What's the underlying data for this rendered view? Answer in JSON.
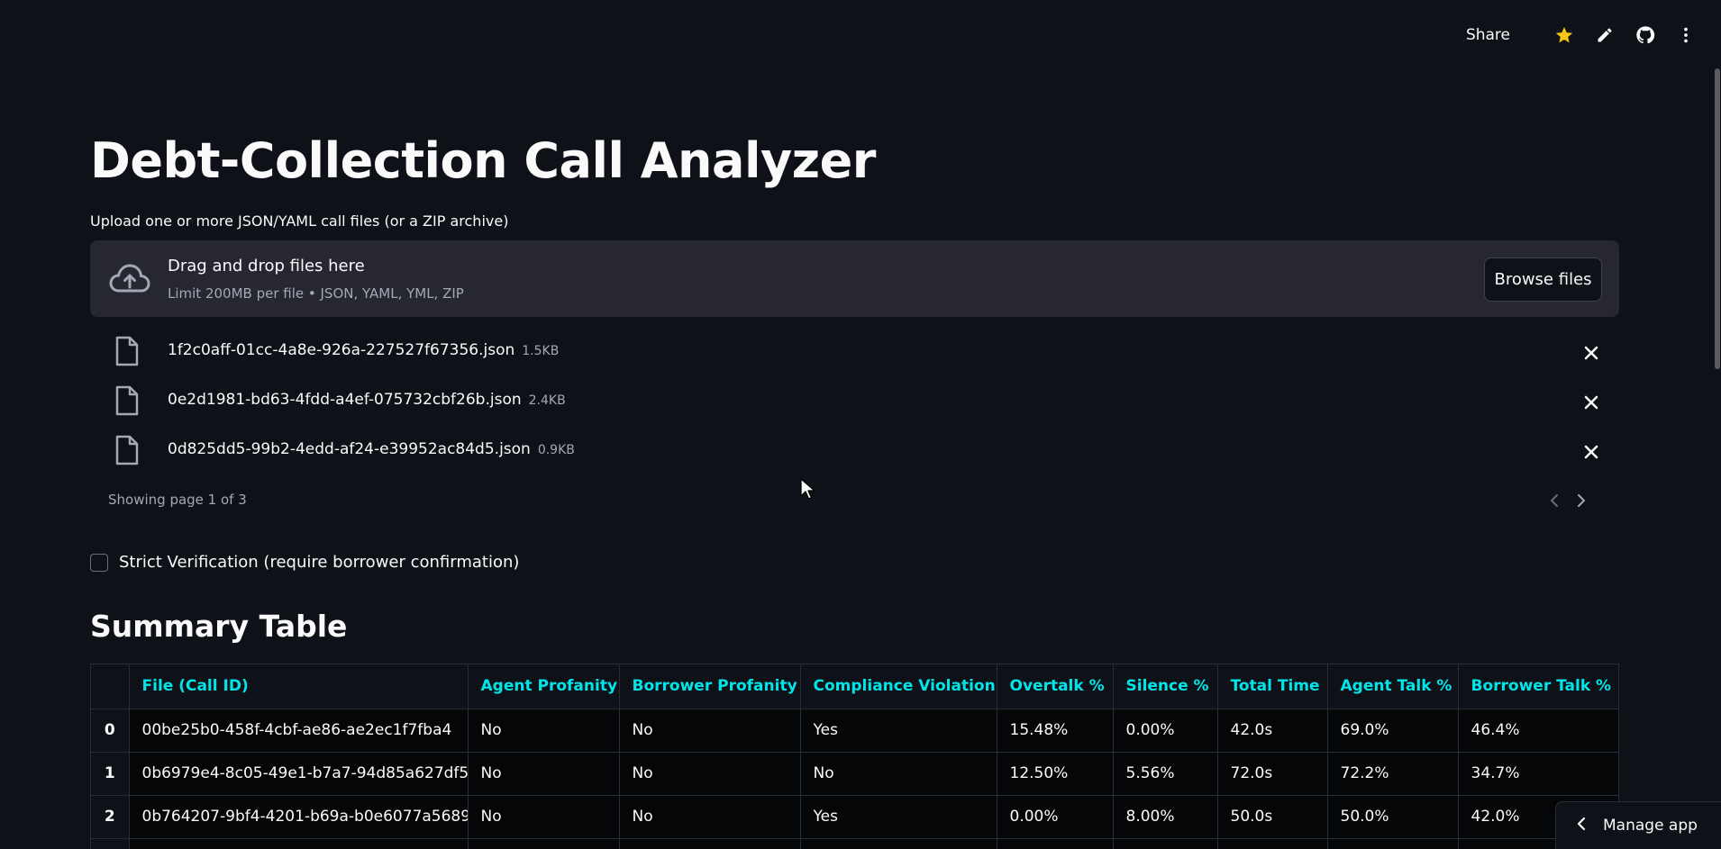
{
  "toolbar": {
    "share_label": "Share",
    "icons": [
      "star-icon",
      "pencil-icon",
      "github-icon",
      "more-vertical-icon"
    ],
    "star_color": "#f5c518"
  },
  "header": {
    "title": "Debt-Collection Call Analyzer"
  },
  "uploader": {
    "label": "Upload one or more JSON/YAML call files (or a ZIP archive)",
    "drop_title": "Drag and drop files here",
    "limit_text": "Limit 200MB per file • JSON, YAML, YML, ZIP",
    "browse_label": "Browse files",
    "files": [
      {
        "name": "1f2c0aff-01cc-4a8e-926a-227527f67356.json",
        "size": "1.5KB"
      },
      {
        "name": "0e2d1981-bd63-4fdd-a4ef-075732cbf26b.json",
        "size": "2.4KB"
      },
      {
        "name": "0d825dd5-99b2-4edd-af24-e39952ac84d5.json",
        "size": "0.9KB"
      }
    ],
    "pager_text": "Showing page 1 of 3"
  },
  "options": {
    "strict_label": "Strict Verification (require borrower confirmation)",
    "strict_checked": false
  },
  "summary": {
    "title": "Summary Table",
    "columns": [
      "",
      "File (Call ID)",
      "Agent Profanity",
      "Borrower Profanity",
      "Compliance Violation",
      "Overtalk %",
      "Silence %",
      "Total Time",
      "Agent Talk %",
      "Borrower Talk %"
    ],
    "header_color": "#00e5e8",
    "rows": [
      [
        "0",
        "00be25b0-458f-4cbf-ae86-ae2ec1f7fba4",
        "No",
        "No",
        "Yes",
        "15.48%",
        "0.00%",
        "42.0s",
        "69.0%",
        "46.4%"
      ],
      [
        "1",
        "0b6979e4-8c05-49e1-b7a7-94d85a627df5",
        "No",
        "No",
        "No",
        "12.50%",
        "5.56%",
        "72.0s",
        "72.2%",
        "34.7%"
      ],
      [
        "2",
        "0b764207-9bf4-4201-b69a-b0e6077a5689",
        "No",
        "No",
        "Yes",
        "0.00%",
        "8.00%",
        "50.0s",
        "50.0%",
        "42.0%"
      ]
    ]
  },
  "footer": {
    "manage_label": "Manage app"
  }
}
